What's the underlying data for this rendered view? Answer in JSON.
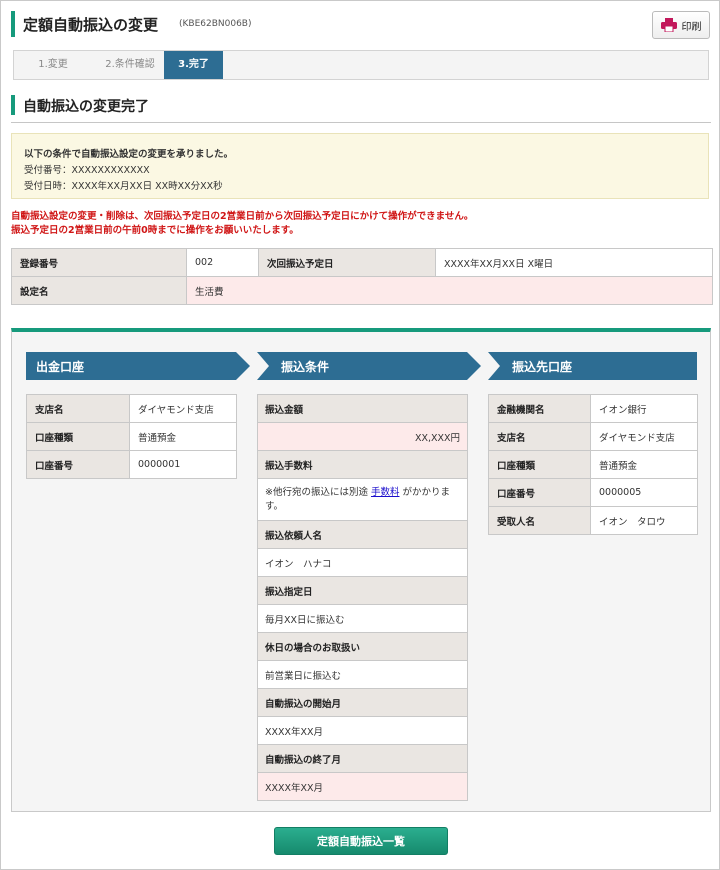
{
  "header": {
    "title": "定額自動振込の変更",
    "code": "(KBE62BN006B)",
    "print_label": "印刷"
  },
  "steps": [
    {
      "label": "1.変更"
    },
    {
      "label": "2.条件確認"
    },
    {
      "label": "3.完了"
    }
  ],
  "section_title": "自動振込の変更完了",
  "notice": {
    "line1": "以下の条件で自動振込設定の変更を承りました。",
    "line2": "受付番号：XXXXXXXXXXXX",
    "line3": "受付日時：XXXX年XX月XX日 XX時XX分XX秒"
  },
  "warning": {
    "line1": "自動振込設定の変更・削除は、次回振込予定日の2営業日前から次回振込予定日にかけて操作ができません。",
    "line2": "振込予定日の2営業日前の午前0時までに操作をお願いいたします。"
  },
  "info": {
    "reg_no_label": "登録番号",
    "reg_no": "002",
    "next_date_label": "次回振込予定日",
    "next_date": "XXXX年XX月XX日 X曜日",
    "setting_name_label": "設定名",
    "setting_name": "生活費"
  },
  "source": {
    "heading": "出金口座",
    "branch_label": "支店名",
    "branch": "ダイヤモンド支店",
    "type_label": "口座種類",
    "type": "普通預金",
    "number_label": "口座番号",
    "number": "0000001"
  },
  "conditions": {
    "heading": "振込条件",
    "amount_label": "振込金額",
    "amount": "XX,XXX円",
    "fee_label": "振込手数料",
    "fee_pre": "※他行宛の振込には別途 ",
    "fee_link": "手数料",
    "fee_post": " がかかります。",
    "requester_label": "振込依頼人名",
    "requester": "イオン　ハナコ",
    "date_label": "振込指定日",
    "date": "毎月XX日に振込む",
    "holiday_label": "休日の場合のお取扱い",
    "holiday": "前営業日に振込む",
    "start_label": "自動振込の開始月",
    "start": "XXXX年XX月",
    "end_label": "自動振込の終了月",
    "end": "XXXX年XX月"
  },
  "dest": {
    "heading": "振込先口座",
    "bank_label": "金融機関名",
    "bank": "イオン銀行",
    "branch_label": "支店名",
    "branch": "ダイヤモンド支店",
    "type_label": "口座種類",
    "type": "普通預金",
    "number_label": "口座番号",
    "number": "0000005",
    "recipient_label": "受取人名",
    "recipient": "イオン　タロウ"
  },
  "footer": {
    "list_button": "定額自動振込一覧"
  },
  "colors": {
    "accent": "#169a7c",
    "head_blue": "#2d6d93",
    "warning": "#d01616",
    "print_icon": "#c2185b"
  }
}
